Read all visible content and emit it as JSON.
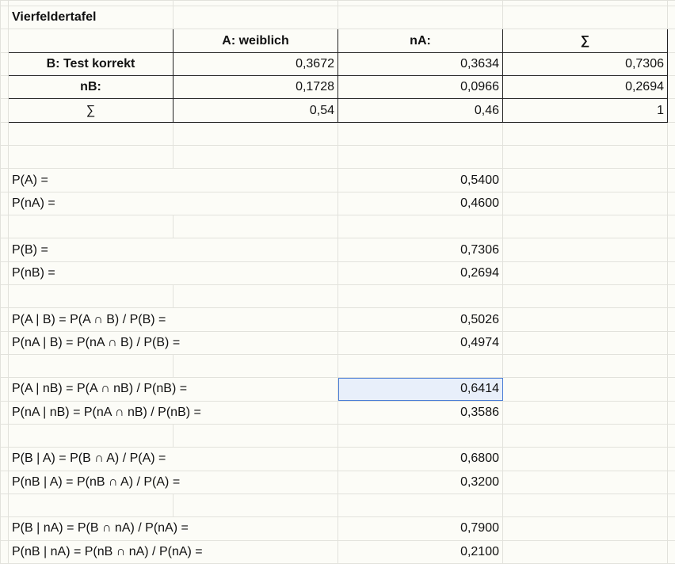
{
  "title": "Vierfeldertafel",
  "table": {
    "headers": [
      "",
      "A: weiblich",
      "nA:",
      "∑"
    ],
    "rows": [
      {
        "label": "B: Test korrekt",
        "values": [
          "0,3672",
          "0,3634",
          "0,7306"
        ]
      },
      {
        "label": "nB:",
        "values": [
          "0,1728",
          "0,0966",
          "0,2694"
        ]
      },
      {
        "label": "∑",
        "values": [
          "0,54",
          "0,46",
          "1"
        ]
      }
    ]
  },
  "probabilities": [
    {
      "label": "P(A) =",
      "value": "0,5400"
    },
    {
      "label": "P(nA) =",
      "value": "0,4600"
    },
    {
      "label": "P(B) =",
      "value": "0,7306"
    },
    {
      "label": "P(nB) =",
      "value": "0,2694"
    },
    {
      "label": "P(A | B) = P(A ∩ B) / P(B) =",
      "value": "0,5026"
    },
    {
      "label": "P(nA | B) = P(nA ∩ B) / P(B) =",
      "value": "0,4974"
    },
    {
      "label": "P(A | nB) = P(A ∩ nB) / P(nB) =",
      "value": "0,6414"
    },
    {
      "label": "P(nA | nB) = P(nA ∩ nB) / P(nB) =",
      "value": "0,3586"
    },
    {
      "label": "P(B | A) = P(B ∩ A) / P(A) =",
      "value": "0,6800"
    },
    {
      "label": "P(nB | A) = P(nB ∩ A) / P(A) =",
      "value": "0,3200"
    },
    {
      "label": "P(B | nA) = P(B ∩ nA) / P(nA) =",
      "value": "0,7900"
    },
    {
      "label": "P(nB | nA) = P(nB ∩ nA) / P(nA) =",
      "value": "0,2100"
    }
  ]
}
